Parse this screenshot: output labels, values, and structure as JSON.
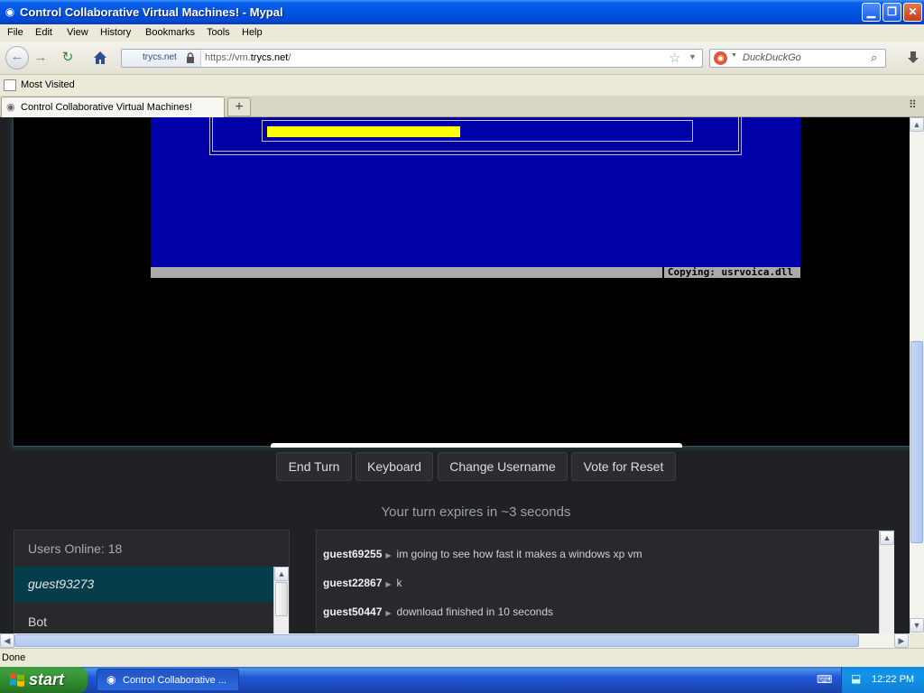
{
  "window": {
    "title": "Control Collaborative Virtual Machines! - Mypal",
    "minimize_glyph": "▁",
    "restore_glyph": "❐",
    "close_glyph": "✕"
  },
  "menu": [
    "File",
    "Edit",
    "View",
    "History",
    "Bookmarks",
    "Tools",
    "Help"
  ],
  "navigation": {
    "identity_host": "trycs.net",
    "url_prefix": "https://vm.",
    "url_domain": "trycs.net",
    "url_suffix": "/",
    "search_placeholder": "DuckDuckGo"
  },
  "bookmarks": {
    "most_visited": "Most Visited"
  },
  "tabs": [
    {
      "label": "Control Collaborative Virtual Machines!"
    }
  ],
  "vm": {
    "setup_status": "Copying: usrvoica.dll",
    "progress_fraction": 0.46
  },
  "controls": {
    "end_turn": "End Turn",
    "keyboard": "Keyboard",
    "change_username": "Change Username",
    "vote_reset": "Vote for Reset"
  },
  "turn_message": "Your turn expires in ~3 seconds",
  "users": {
    "header": "Users Online: 18",
    "list": [
      "guest93273",
      "Bot"
    ]
  },
  "chat": [
    {
      "user": "guest69255",
      "message": "im going to see how fast it makes a windows xp vm"
    },
    {
      "user": "guest22867",
      "message": "k"
    },
    {
      "user": "guest50447",
      "message": "download finished in 10 seconds"
    }
  ],
  "status": "Done",
  "taskbar": {
    "start_label": "start",
    "task_label": "Control Collaborative ...",
    "clock": "12:22 PM"
  },
  "colors": {
    "titlebar": "#0054e3",
    "setup_blue": "#0000a8",
    "progress_yellow": "#ffff00",
    "selected_user": "#063d4a",
    "page_bg": "#202124"
  }
}
